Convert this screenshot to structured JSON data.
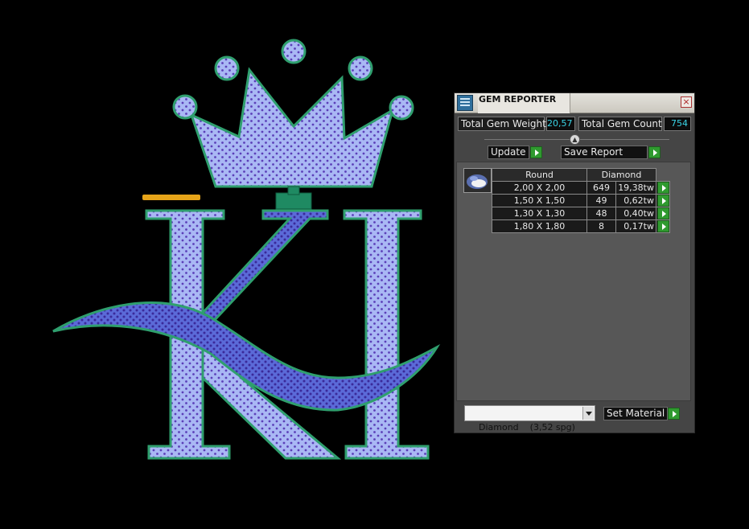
{
  "panel": {
    "title": "GEM REPORTER",
    "close_label": "×",
    "total_weight_label": "Total Gem Weight",
    "total_weight_value": "20,57",
    "total_count_label": "Total Gem Count",
    "total_count_value": "754",
    "update_label": "Update",
    "save_label": "Save Report",
    "table": {
      "headers": [
        "Round",
        "Diamond"
      ],
      "rows": [
        {
          "size": "2,00 X 2,00",
          "count": "649",
          "weight": "19,38tw"
        },
        {
          "size": "1,50 X 1,50",
          "count": "49",
          "weight": "0,62tw"
        },
        {
          "size": "1,30 X 1,30",
          "count": "48",
          "weight": "0,40tw"
        },
        {
          "size": "1,80 X 1,80",
          "count": "8",
          "weight": "0,17tw"
        }
      ]
    },
    "material_value": "Diamond    (3,52 spg)",
    "set_material_label": "Set Material"
  },
  "colors": {
    "gem_fill": "#a9b8f4",
    "gem_dark": "#5b6ad8",
    "outline": "#2f9f6e",
    "gold_bar": "#e6a419",
    "panel_bg": "#454545",
    "value_text": "#39d4e6",
    "go_green": "#2f9a2f"
  }
}
